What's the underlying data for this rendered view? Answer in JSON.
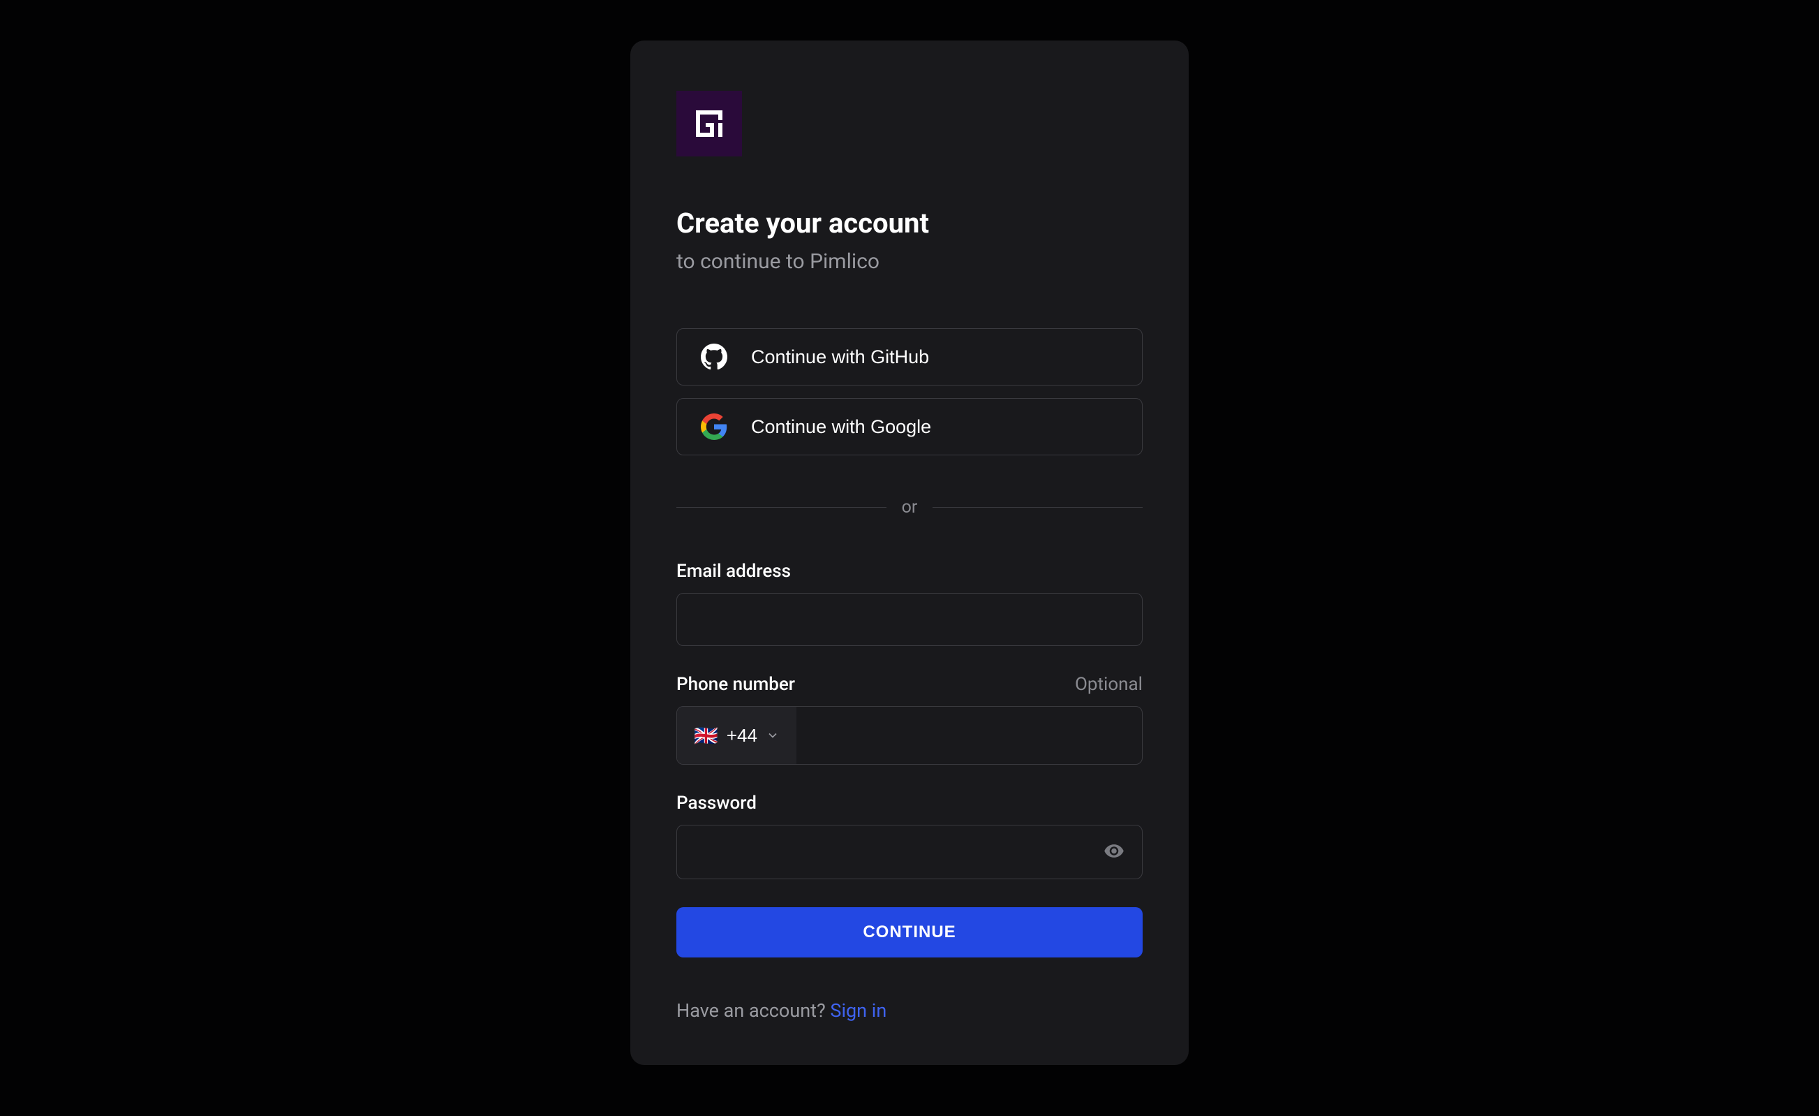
{
  "heading": "Create your account",
  "subheading": "to continue to Pimlico",
  "social": {
    "github_label": "Continue with GitHub",
    "google_label": "Continue with Google"
  },
  "divider": "or",
  "fields": {
    "email": {
      "label": "Email address",
      "value": ""
    },
    "phone": {
      "label": "Phone number",
      "hint": "Optional",
      "country_flag": "🇬🇧",
      "country_code": "+44",
      "value": ""
    },
    "password": {
      "label": "Password",
      "value": ""
    }
  },
  "submit_label": "CONTINUE",
  "footer": {
    "prompt": "Have an account? ",
    "link_label": "Sign in"
  }
}
